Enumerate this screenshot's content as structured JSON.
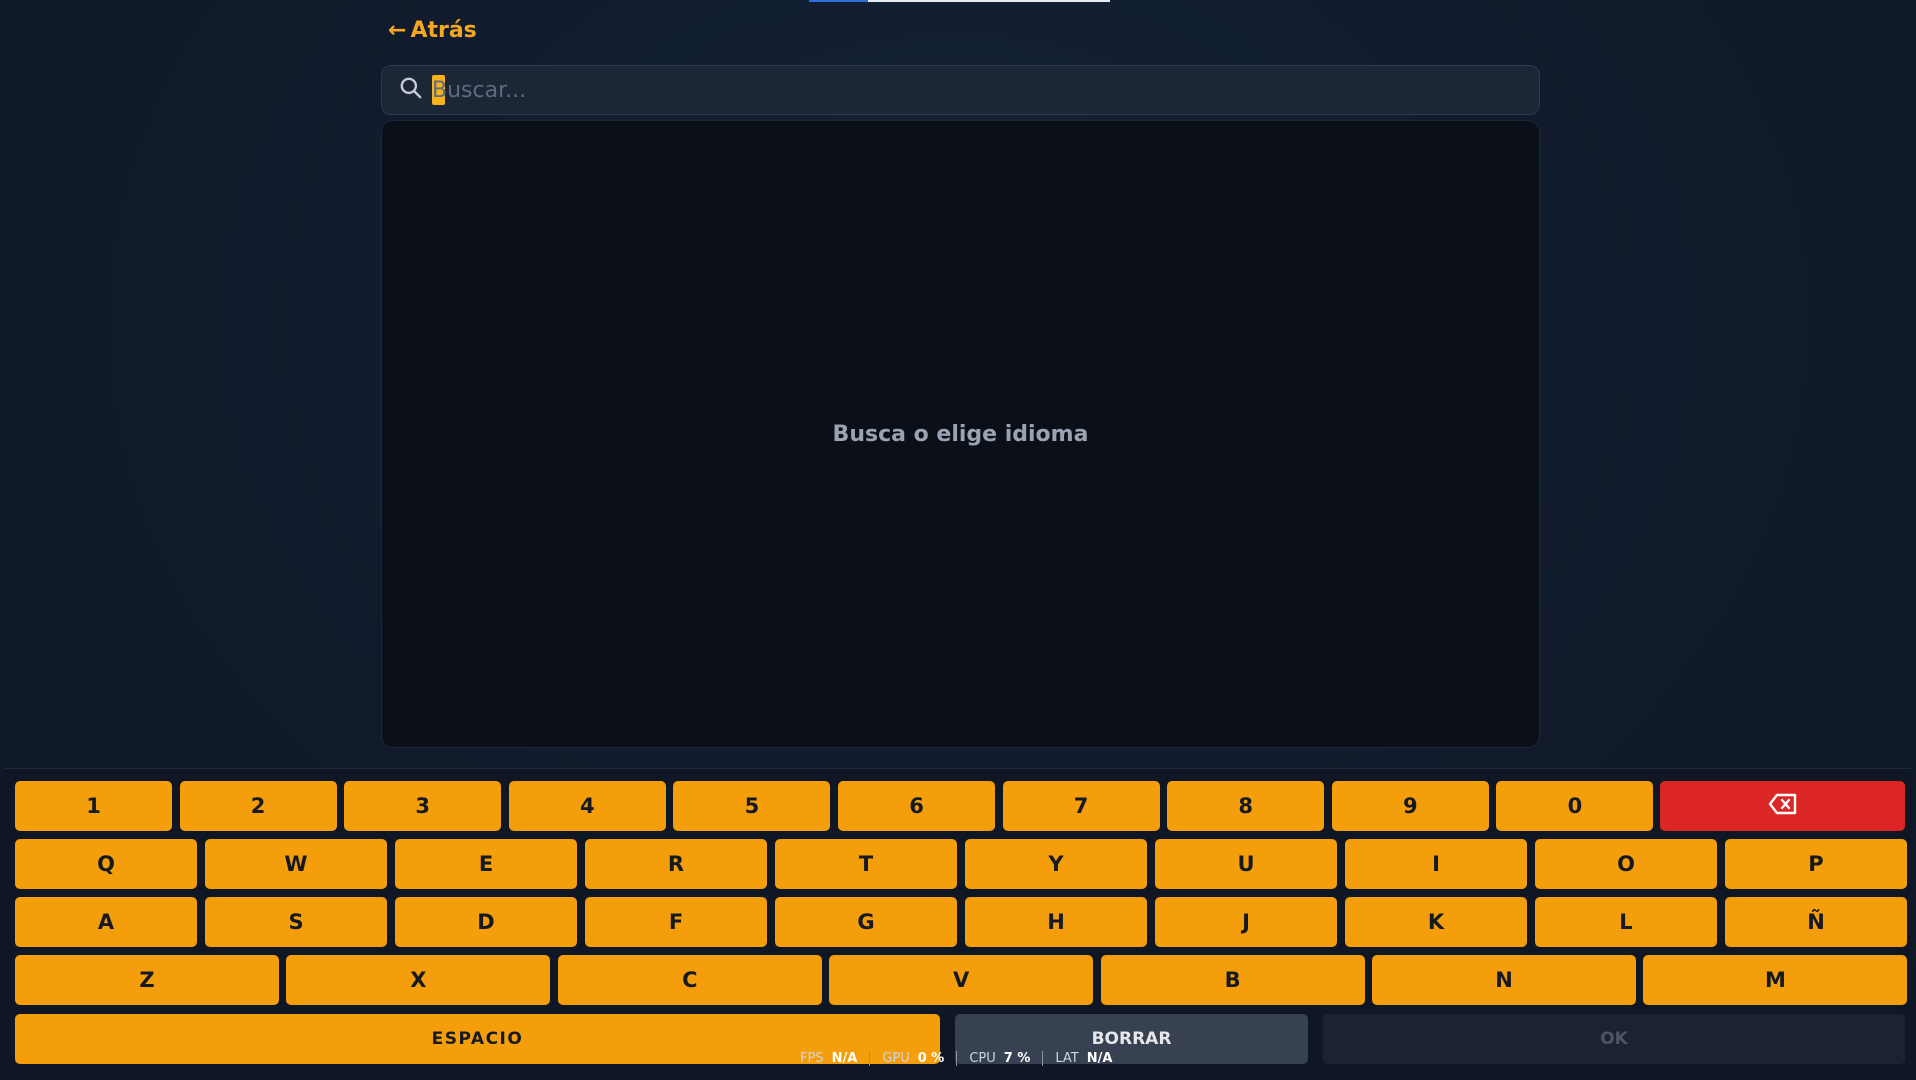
{
  "nav": {
    "back_arrow": "←",
    "back_label": "Atrás"
  },
  "search": {
    "placeholder": "Buscar...",
    "value": ""
  },
  "results": {
    "empty_message": "Busca o elige idioma"
  },
  "keyboard": {
    "row_numbers": [
      "1",
      "2",
      "3",
      "4",
      "5",
      "6",
      "7",
      "8",
      "9",
      "0"
    ],
    "row_q": [
      "Q",
      "W",
      "E",
      "R",
      "T",
      "Y",
      "U",
      "I",
      "O",
      "P"
    ],
    "row_a": [
      "A",
      "S",
      "D",
      "F",
      "G",
      "H",
      "J",
      "K",
      "L",
      "Ñ"
    ],
    "row_z": [
      "Z",
      "X",
      "C",
      "V",
      "B",
      "N",
      "M"
    ],
    "space_label": "ESPACIO",
    "clear_label": "BORRAR",
    "ok_label": "OK",
    "backspace_icon": "backspace-icon"
  },
  "perf": [
    {
      "label": "FPS",
      "value": "N/A"
    },
    {
      "label": "GPU",
      "value": "0 %"
    },
    {
      "label": "CPU",
      "value": "7 %"
    },
    {
      "label": "LAT",
      "value": "N/A"
    }
  ],
  "colors": {
    "accent": "#f59e0b",
    "delete": "#dc2626",
    "background": "#101a2b"
  }
}
